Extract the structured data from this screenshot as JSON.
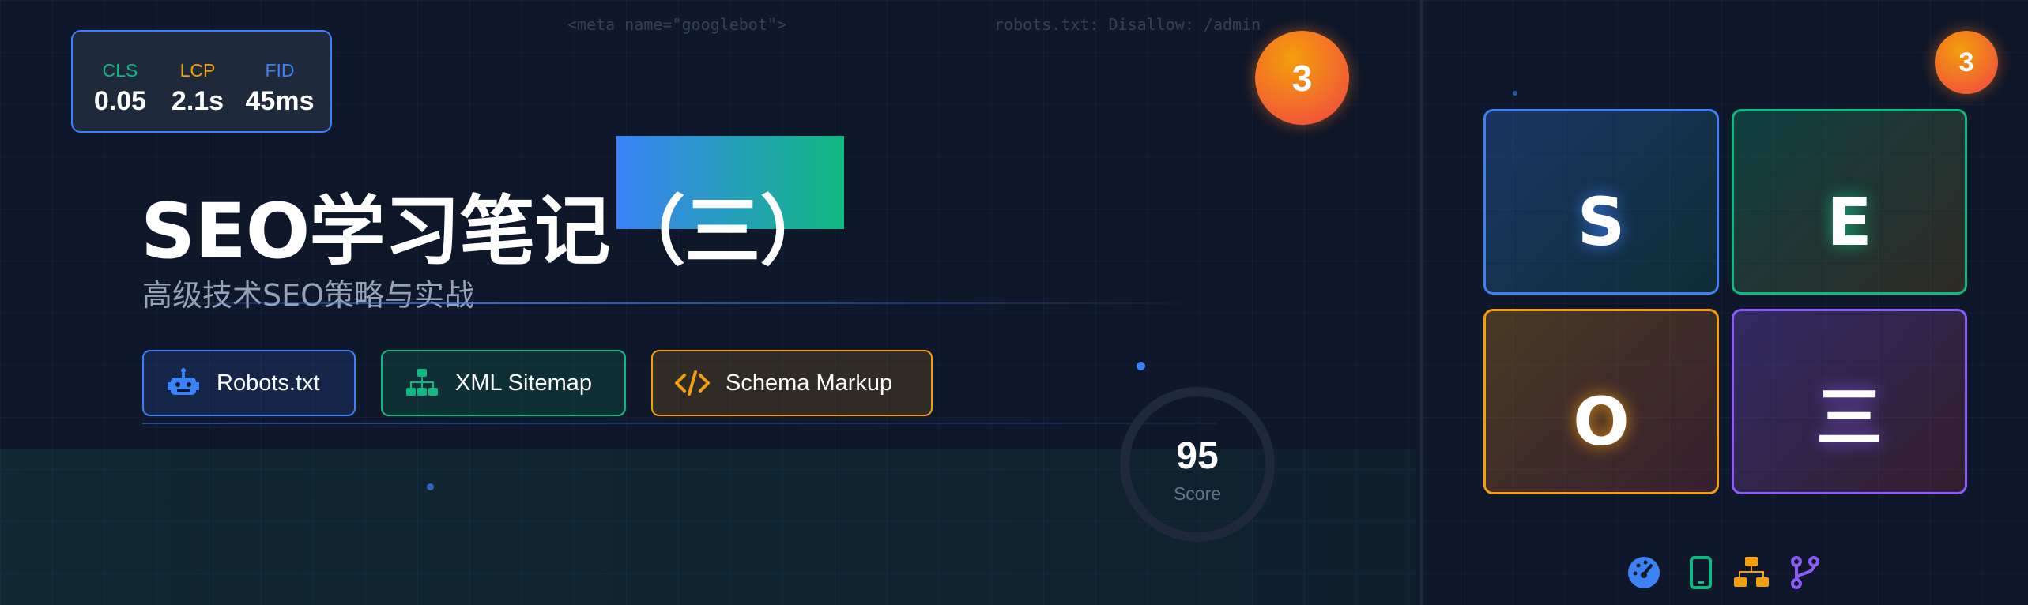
{
  "code_snippets": [
    "<meta name=\"googlebot\">",
    "robots.txt: Disallow: /admin"
  ],
  "metrics": [
    {
      "label": "CLS",
      "value": "0.05",
      "color": "#10b981"
    },
    {
      "label": "LCP",
      "value": "2.1s",
      "color": "#f59e0b"
    },
    {
      "label": "FID",
      "value": "45ms",
      "color": "#3b82f6"
    }
  ],
  "title": "SEO学习笔记（三）",
  "subtitle": "高级技术SEO策略与实战",
  "tags": [
    {
      "label": "Robots.txt",
      "icon": "robot-icon",
      "color": "#3b82f6"
    },
    {
      "label": "XML Sitemap",
      "icon": "sitemap-icon",
      "color": "#10b981"
    },
    {
      "label": "Schema Markup",
      "icon": "code-icon",
      "color": "#f59e0b"
    }
  ],
  "score": {
    "value": "95",
    "label": "Score"
  },
  "badges": [
    "3",
    "3"
  ],
  "tiles": [
    {
      "letter": "S",
      "color": "#3b82f6"
    },
    {
      "letter": "E",
      "color": "#10b981"
    },
    {
      "letter": "O",
      "color": "#f59e0b"
    },
    {
      "letter": "三",
      "color": "#8b5cf6"
    }
  ],
  "bottom_icons": [
    {
      "name": "gauge-icon",
      "color": "#3b82f6"
    },
    {
      "name": "mobile-icon",
      "color": "#10b981"
    },
    {
      "name": "network-icon",
      "color": "#f59e0b"
    },
    {
      "name": "branch-icon",
      "color": "#8b5cf6"
    }
  ]
}
